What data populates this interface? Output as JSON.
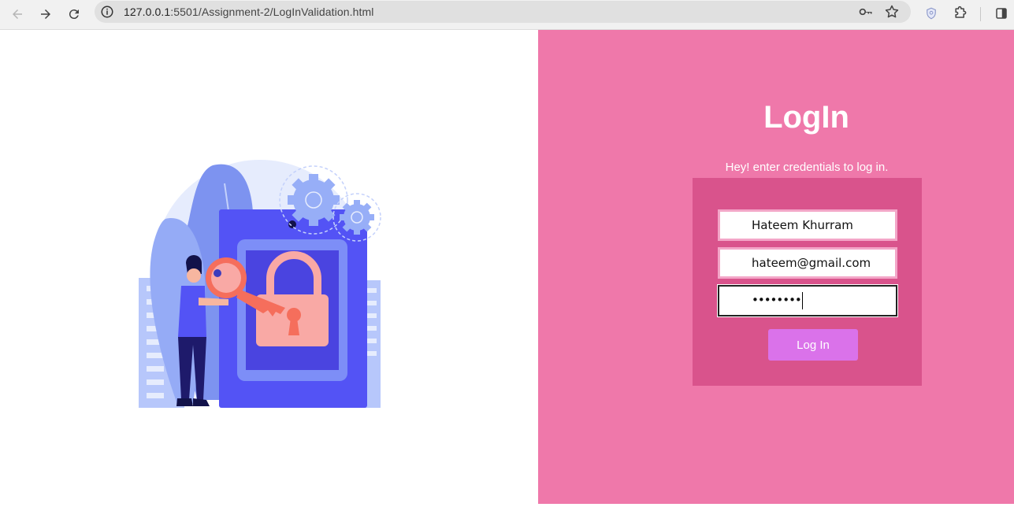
{
  "browser": {
    "url_host": "127.0.0.1",
    "url_rest": ":5501/Assignment-2/LogInValidation.html"
  },
  "login": {
    "title": "LogIn",
    "subtitle": "Hey! enter credentials to log in.",
    "name_value": "Hateem Khurram",
    "email_value": "hateem@gmail.com",
    "password_mask": "••••••••",
    "button_label": "Log In"
  },
  "colors": {
    "right_pane": "#ef78aa",
    "form_box": "#d9538c",
    "button": "#da72ea",
    "illustration_primary": "#5353f5"
  },
  "icons": [
    "back-icon",
    "forward-icon",
    "reload-icon",
    "site-info-icon",
    "key-icon",
    "star-icon",
    "shield-extension-icon",
    "puzzle-icon",
    "sidepanel-icon"
  ]
}
